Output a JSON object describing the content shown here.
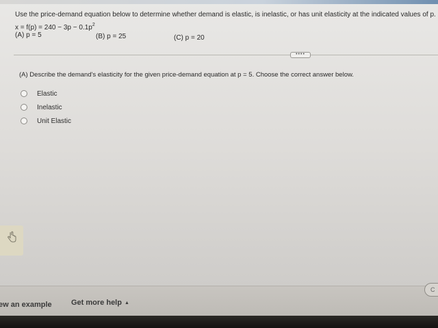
{
  "problem": {
    "instruction": "Use the price-demand equation below to determine whether demand is elastic, is inelastic, or has unit elasticity at the indicated values of p.",
    "equation_main": "x = f(p) = 240 − 3p − 0.1p",
    "equation_exponent": "2",
    "parts": {
      "a": "(A) p = 5",
      "b": "(B) p = 25",
      "c": "(C) p = 20"
    }
  },
  "more_button": {
    "label": "••••"
  },
  "question": {
    "prompt": "(A) Describe the demand's elasticity for the given price-demand equation at p = 5. Choose the correct answer below.",
    "options": [
      "Elastic",
      "Inelastic",
      "Unit Elastic"
    ]
  },
  "footer": {
    "view_example": "ew an example",
    "get_more_help": "Get more help",
    "get_more_help_caret": "▲",
    "check_answer": "C"
  },
  "icons": {
    "side_tab": "hand-pointer-icon"
  }
}
